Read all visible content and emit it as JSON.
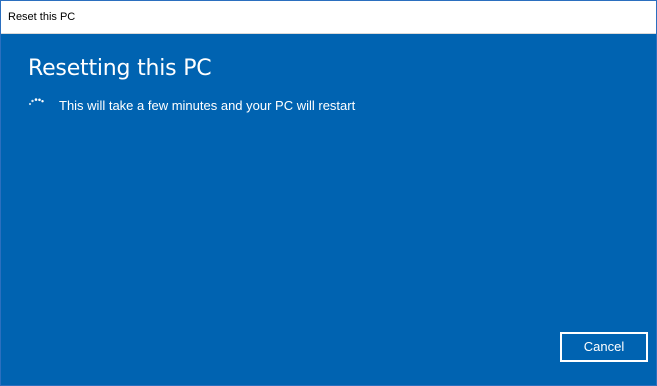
{
  "window": {
    "title": "Reset this PC"
  },
  "content": {
    "heading": "Resetting this PC",
    "status_text": "This will take a few minutes and your PC will restart",
    "spinner_icon": "loading-spinner-icon"
  },
  "footer": {
    "cancel_label": "Cancel"
  },
  "colors": {
    "background_blue": "#0063b1",
    "text_white": "#ffffff",
    "titlebar_white": "#ffffff"
  }
}
